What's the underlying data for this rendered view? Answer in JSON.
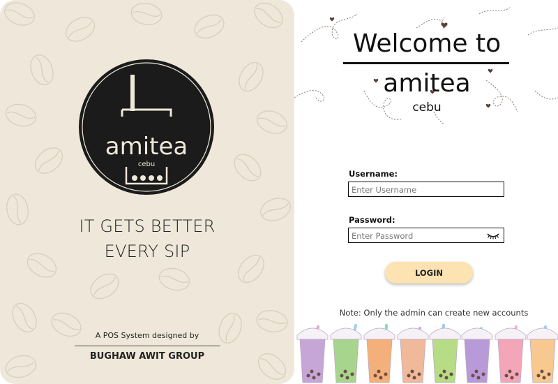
{
  "left_panel": {
    "logo": {
      "name": "amitea",
      "sub": "cebu"
    },
    "tagline": [
      "IT GETS BETTER",
      "EVERY SIP"
    ],
    "designed_by": "A POS System designed by",
    "group": "BUGHAW AWIT GROUP"
  },
  "right_panel": {
    "welcome": "Welcome to",
    "brand": "amitea",
    "brand_sub": "cebu",
    "username": {
      "label": "Username:",
      "placeholder": "Enter Username"
    },
    "password": {
      "label": "Password:",
      "placeholder": "Enter Password"
    },
    "login_label": "LOGIN",
    "note": "Note: Only the admin can create new accounts"
  },
  "colors": {
    "left_background": "#efe8da",
    "logo_circle": "#1b1b1b",
    "logo_cream": "#efe8da",
    "login_button": "#fde3b2"
  },
  "icons": [
    "coffee-bean-pattern",
    "bubble-tea-logo",
    "eye-closed-icon",
    "heart-doodle",
    "bubble-tea-cups"
  ]
}
